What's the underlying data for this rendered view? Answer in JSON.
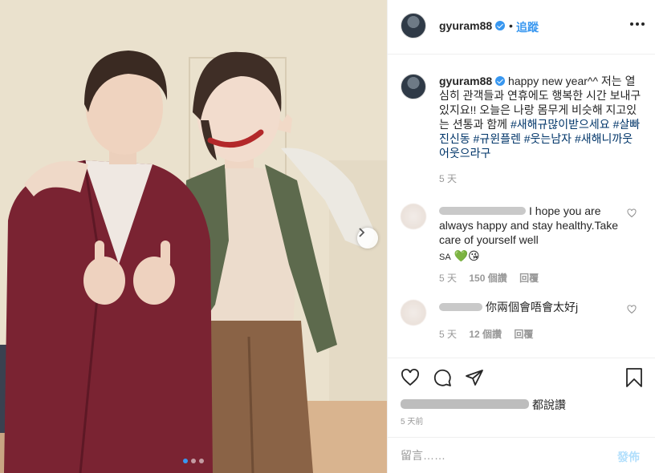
{
  "post": {
    "username": "gyuram88",
    "separator": "•",
    "follow_label": "追蹤",
    "caption": {
      "username": "gyuram88",
      "text": "happy new year^^ 저는 열심히 관객들과 연휴에도 행복한 시간 보내구 있지요!! 오늘은 나랑 몸무게 비슷해 지고있는 션통과 함께",
      "hashtags": [
        "#새해규많이받으세요",
        "#살빠진신동",
        "#규윈플렌",
        "#웃는남자",
        "#새해니까웃어웃으라구"
      ],
      "time": "5 天"
    },
    "comments": [
      {
        "text": "I hope you are always happy and stay healthy.Take care of yourself well",
        "text_suffix": "SA",
        "emojis": [
          "💚",
          "😘"
        ],
        "time": "5 天",
        "likes": "150 個讚",
        "reply": "回覆"
      },
      {
        "text": "你兩個會唔會太好j",
        "time": "5 天",
        "likes": "12 個讚",
        "reply": "回覆"
      }
    ],
    "likes_suffix": "都說讚",
    "posted_ago": "5 天前",
    "comment_placeholder": "留言……",
    "post_button": "發佈",
    "carousel": {
      "count": 3,
      "active_index": 0
    },
    "colors": {
      "link": "#3897f0",
      "hashtag": "#003569",
      "muted": "#999999"
    },
    "icons": [
      "heart-icon",
      "comment-icon",
      "share-icon",
      "bookmark-icon",
      "more-options-icon",
      "verified-badge-icon",
      "chevron-right-icon"
    ]
  }
}
